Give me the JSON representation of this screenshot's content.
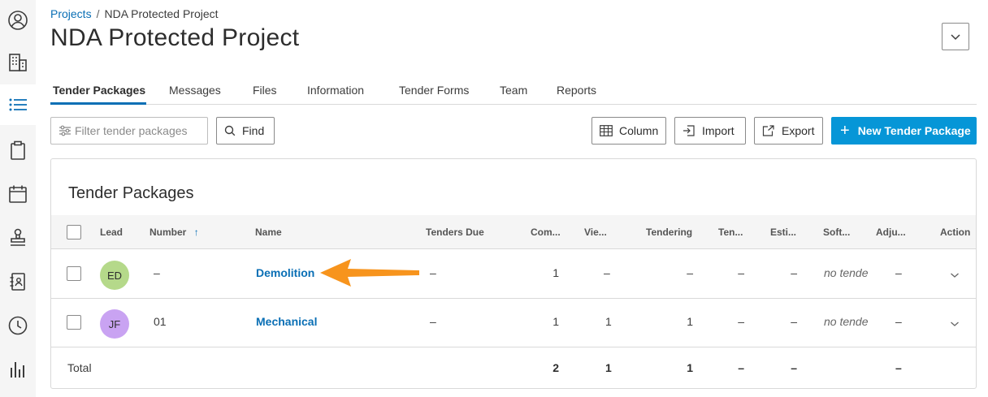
{
  "sidebar": {
    "items": [
      {
        "icon": "user-circle-icon"
      },
      {
        "icon": "building-icon"
      },
      {
        "icon": "list-icon"
      },
      {
        "icon": "clipboard-icon"
      },
      {
        "icon": "calendar-icon"
      },
      {
        "icon": "stamp-icon"
      },
      {
        "icon": "contacts-book-icon"
      },
      {
        "icon": "clock-icon"
      },
      {
        "icon": "bar-chart-icon"
      }
    ],
    "active_index": 2,
    "accent": "#0a6fb5"
  },
  "breadcrumb": {
    "parent": "Projects",
    "separator": "/",
    "current": "NDA Protected Project"
  },
  "page_title": "NDA Protected Project",
  "tabs": [
    "Tender Packages",
    "Messages",
    "Files",
    "Information",
    "Tender Forms",
    "Team",
    "Reports"
  ],
  "active_tab": "Tender Packages",
  "toolbar": {
    "filter_placeholder": "Filter tender packages",
    "find_label": "Find",
    "column_label": "Column",
    "import_label": "Import",
    "export_label": "Export",
    "new_label": "New Tender Package",
    "primary_color": "#0696d7"
  },
  "table": {
    "title": "Tender Packages",
    "headers": {
      "lead": "Lead",
      "number": "Number",
      "sort_icon": "↑",
      "name": "Name",
      "tenders_due": "Tenders Due",
      "committed": "Com...",
      "viewed": "Vie...",
      "tendering": "Tendering",
      "tendered": "Ten...",
      "estimate": "Esti...",
      "soft": "Soft...",
      "adjusted": "Adju...",
      "action": "Action"
    },
    "rows": [
      {
        "lead_initials": "ED",
        "lead_color": "#b5d98a",
        "number": "–",
        "name": "Demolition",
        "tenders_due": "–",
        "committed": "1",
        "viewed": "–",
        "tendering": "–",
        "tendered": "–",
        "estimate": "–",
        "soft": "no tende",
        "adjusted": "–"
      },
      {
        "lead_initials": "JF",
        "lead_color": "#c9a3f2",
        "number": "01",
        "name": "Mechanical",
        "tenders_due": "–",
        "committed": "1",
        "viewed": "1",
        "tendering": "1",
        "tendered": "–",
        "estimate": "–",
        "soft": "no tende",
        "adjusted": "–"
      }
    ],
    "total": {
      "label": "Total",
      "committed": "2",
      "viewed": "1",
      "tendering": "1",
      "tendered": "–",
      "estimate": "–",
      "adjusted": "–"
    }
  },
  "annotation": {
    "arrow_color": "#f7941d"
  }
}
